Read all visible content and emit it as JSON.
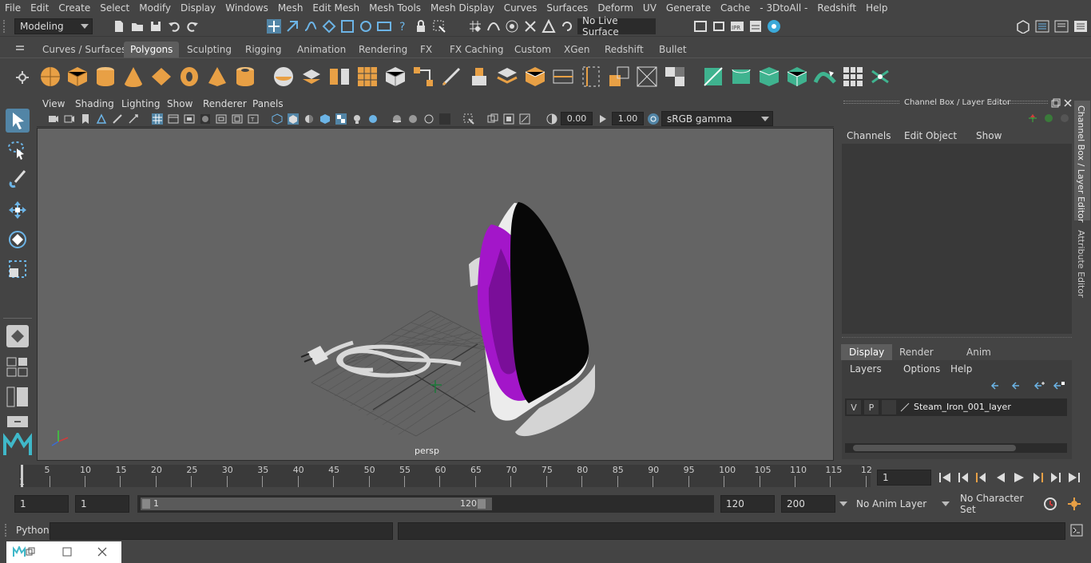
{
  "menubar": [
    "File",
    "Edit",
    "Create",
    "Select",
    "Modify",
    "Display",
    "Windows",
    "Mesh",
    "Edit Mesh",
    "Mesh Tools",
    "Mesh Display",
    "Curves",
    "Surfaces",
    "Deform",
    "UV",
    "Generate",
    "Cache",
    "- 3DtoAll -",
    "Redshift",
    "Help"
  ],
  "status": {
    "mode": "Modeling",
    "live_surface": "No Live Surface"
  },
  "shelf_tabs": [
    "Curves / Surfaces",
    "Polygons",
    "Sculpting",
    "Rigging",
    "Animation",
    "Rendering",
    "FX",
    "FX Caching",
    "Custom",
    "XGen",
    "Redshift",
    "Bullet"
  ],
  "shelf_active": "Polygons",
  "viewport": {
    "menus": [
      "View",
      "Shading",
      "Lighting",
      "Show",
      "Renderer",
      "Panels"
    ],
    "exposure": "0.00",
    "gamma": "1.00",
    "colorspace": "sRGB gamma",
    "camera_label": "persp"
  },
  "channel_box": {
    "title": "Channel Box / Layer Editor",
    "menus": [
      "Channels",
      "Edit",
      "Object",
      "Show"
    ]
  },
  "layer_editor": {
    "tabs": [
      "Display",
      "Render",
      "Anim"
    ],
    "active_tab": "Display",
    "menus": [
      "Layers",
      "Options",
      "Help"
    ],
    "layer": {
      "v": "V",
      "p": "P",
      "name": "Steam_Iron_001_layer"
    }
  },
  "side_tabs": [
    "Channel Box / Layer Editor",
    "Attribute Editor"
  ],
  "timeline": {
    "ticks": [
      "5",
      "10",
      "15",
      "20",
      "25",
      "30",
      "35",
      "40",
      "45",
      "50",
      "55",
      "60",
      "65",
      "70",
      "75",
      "80",
      "85",
      "90",
      "95",
      "100",
      "105",
      "110",
      "115",
      "12"
    ],
    "start_label": "1",
    "current_frame": "1"
  },
  "range": {
    "start": "1",
    "playback_start": "1",
    "slider_start": "1",
    "slider_end": "120",
    "playback_end": "120",
    "end": "200",
    "anim_layer": "No Anim Layer",
    "char_set": "No Character Set"
  },
  "cmd": {
    "label": "Python"
  },
  "colors": {
    "accent": "#5285a6",
    "shelf_orange": "#e8a045",
    "shelf_green": "#3fb38f",
    "mesh_purple": "#a316c9"
  }
}
